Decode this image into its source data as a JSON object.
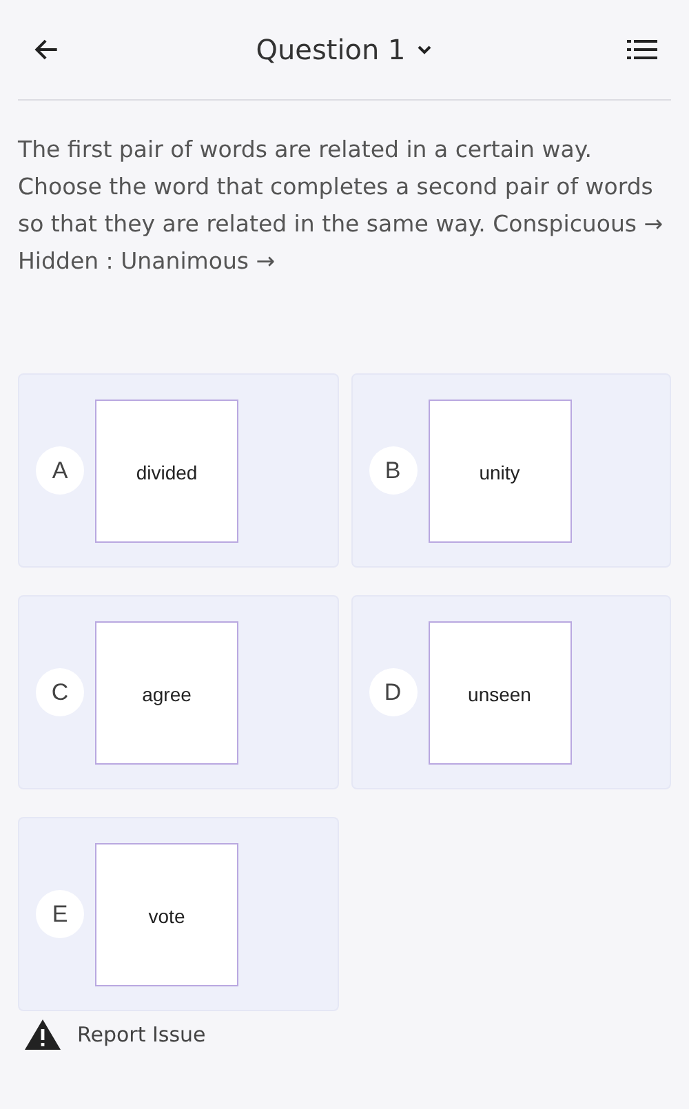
{
  "header": {
    "title": "Question 1"
  },
  "question": "The first pair of words are related in a certain way. Choose the word that completes a second pair of words so that they are related in the same way. Conspicuous → Hidden : Unanimous →",
  "options": [
    {
      "letter": "A",
      "word": "divided"
    },
    {
      "letter": "B",
      "word": "unity"
    },
    {
      "letter": "C",
      "word": "agree"
    },
    {
      "letter": "D",
      "word": "unseen"
    },
    {
      "letter": "E",
      "word": "vote"
    }
  ],
  "report": {
    "label": "Report Issue"
  }
}
